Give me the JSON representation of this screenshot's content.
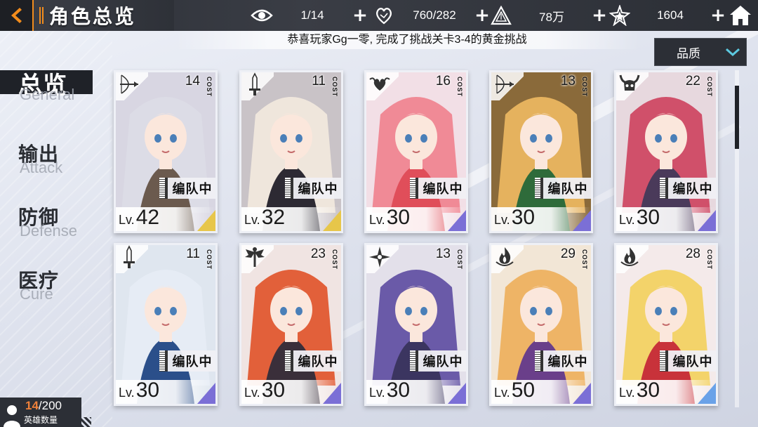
{
  "header": {
    "title": "角色总览",
    "resources": [
      {
        "icon": "eye-icon",
        "value": "1/14"
      },
      {
        "icon": "heart-hand-icon",
        "value": "760/282"
      },
      {
        "icon": "triangle-crystal-icon",
        "value": "78万"
      },
      {
        "icon": "star-crystal-icon",
        "value": "1604"
      }
    ]
  },
  "notice": "恭喜玩家Gg一零, 完成了挑战关卡3-4的黄金挑战",
  "filter": {
    "label": "品质"
  },
  "tabs": [
    {
      "zh": "总览",
      "en": "General",
      "active": true
    },
    {
      "zh": "输出",
      "en": "Attack",
      "active": false
    },
    {
      "zh": "防御",
      "en": "Defense",
      "active": false
    },
    {
      "zh": "医疗",
      "en": "Cure",
      "active": false
    }
  ],
  "hero_count": {
    "current": "14",
    "max": "/200",
    "label": "英雄数量"
  },
  "cost_label": "COST",
  "lv_prefix": "Lv.",
  "team_tag": "编队中",
  "cards": [
    {
      "class_icon": "bow-icon",
      "cost": "14",
      "level": "42",
      "hair": "#dcdce6",
      "outfit": "#6b5a4e",
      "bg": "#d8d6e2",
      "rank": "gold"
    },
    {
      "class_icon": "sword-icon",
      "cost": "11",
      "level": "32",
      "hair": "#efe6dc",
      "outfit": "#2d2a33",
      "bg": "#c9c3c7",
      "rank": "gold"
    },
    {
      "class_icon": "heart-wings-icon",
      "cost": "16",
      "level": "30",
      "hair": "#f08a96",
      "outfit": "#e04e5a",
      "bg": "#f2dfe6",
      "rank": "purple"
    },
    {
      "class_icon": "bow-icon",
      "cost": "13",
      "level": "30",
      "hair": "#e5b25e",
      "outfit": "#2e6b3a",
      "bg": "#8a6a3a",
      "rank": "purple"
    },
    {
      "class_icon": "horned-skull-icon",
      "cost": "22",
      "level": "30",
      "hair": "#d0506a",
      "outfit": "#4a3a5a",
      "bg": "#e7d8de",
      "rank": "purple"
    },
    {
      "class_icon": "sword-icon",
      "cost": "11",
      "level": "30",
      "hair": "#e6ecf5",
      "outfit": "#2b4f8a",
      "bg": "#dfe6ef",
      "rank": "purple"
    },
    {
      "class_icon": "winged-staff-icon",
      "cost": "23",
      "level": "30",
      "hair": "#e2603a",
      "outfit": "#3a2f3a",
      "bg": "#f0e4e2",
      "rank": "purple"
    },
    {
      "class_icon": "shuriken-icon",
      "cost": "13",
      "level": "30",
      "hair": "#6a5aa8",
      "outfit": "#3b3560",
      "bg": "#e3e0ea",
      "rank": "purple"
    },
    {
      "class_icon": "flame-icon",
      "cost": "29",
      "level": "50",
      "hair": "#eeb466",
      "outfit": "#6a3f8a",
      "bg": "#f2e6d6",
      "rank": "purple"
    },
    {
      "class_icon": "flame-icon",
      "cost": "28",
      "level": "30",
      "hair": "#f3d36a",
      "outfit": "#c8323a",
      "bg": "#f4eaea",
      "rank": "blue"
    }
  ]
}
